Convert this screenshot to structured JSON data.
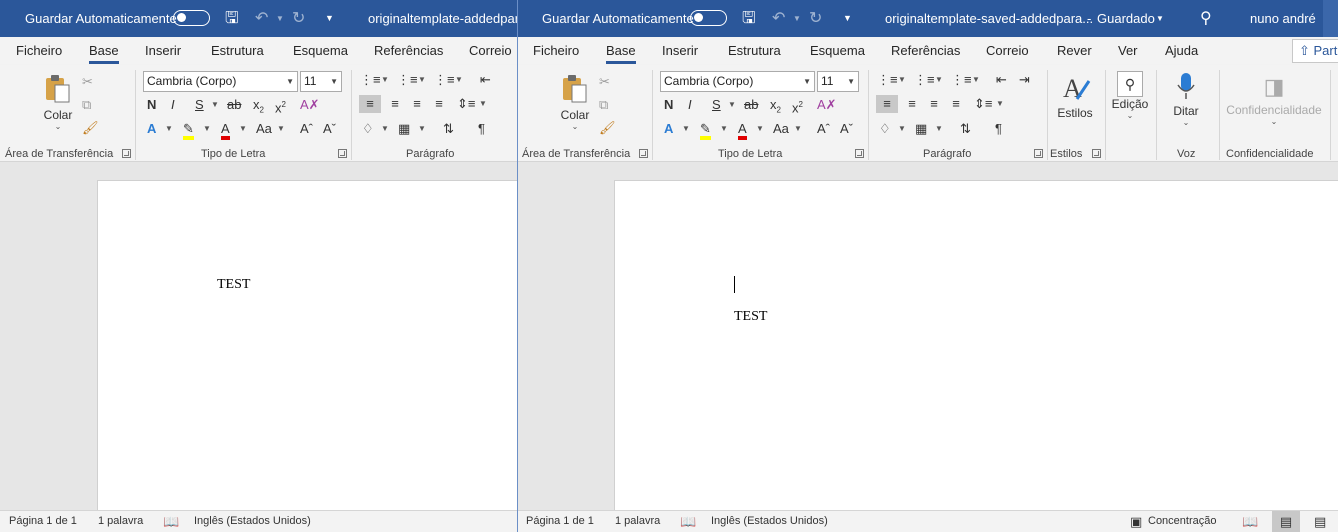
{
  "windows": [
    {
      "autosave_label": "Guardar Automaticamente",
      "doc_title": "originaltemplate-addedpara",
      "tabs": [
        "Ficheiro",
        "Base",
        "Inserir",
        "Estrutura",
        "Esquema",
        "Referências",
        "Correio"
      ],
      "active_tab": "Base",
      "groups": {
        "clipboard": "Área de Transferência",
        "font": "Tipo de Letra",
        "paragraph": "Parágrafo"
      },
      "paste_label": "Colar",
      "font_name": "Cambria (Corpo)",
      "font_size": "11",
      "doc_text": "TEST",
      "status": {
        "page": "Página 1 de 1",
        "words": "1 palavra",
        "language": "Inglês (Estados Unidos)"
      }
    },
    {
      "autosave_label": "Guardar Automaticamente",
      "doc_title": "originaltemplate-saved-addedpara...",
      "save_state": "Guardado",
      "user_name": "nuno andré",
      "share_label": "Part",
      "tabs": [
        "Ficheiro",
        "Base",
        "Inserir",
        "Estrutura",
        "Esquema",
        "Referências",
        "Correio",
        "Rever",
        "Ver",
        "Ajuda"
      ],
      "active_tab": "Base",
      "groups": {
        "clipboard": "Área de Transferência",
        "font": "Tipo de Letra",
        "paragraph": "Parágrafo",
        "styles": "Estilos",
        "voice": "Voz",
        "sensitivity": "Confidencialidade"
      },
      "paste_label": "Colar",
      "styles_label": "Estilos",
      "editing_label": "Edição",
      "dictate_label": "Ditar",
      "sensitivity_label": "Confidencialidade",
      "font_name": "Cambria (Corpo)",
      "font_size": "11",
      "doc_text": "TEST",
      "status": {
        "page": "Página 1 de 1",
        "words": "1 palavra",
        "language": "Inglês (Estados Unidos)",
        "focus": "Concentração"
      }
    }
  ],
  "colors": {
    "titlebar": "#2b579a",
    "highlight": "#ffff00",
    "font_color": "#e00000",
    "text_effects": "#2b7cd3"
  }
}
